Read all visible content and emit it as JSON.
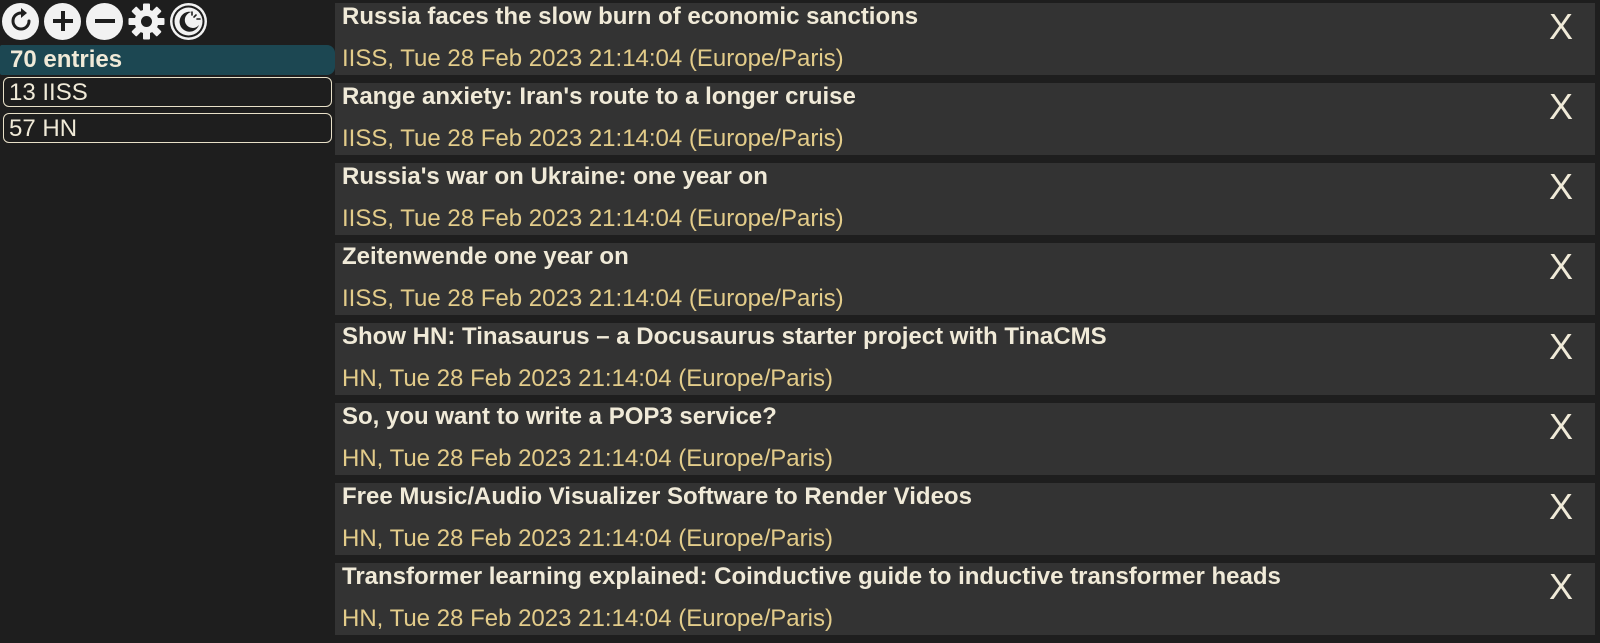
{
  "toolbar": {
    "icons": [
      "refresh-icon",
      "plus-icon",
      "minus-icon",
      "gear-icon",
      "theme-icon"
    ]
  },
  "sidebar": {
    "all_label": "70 entries",
    "feeds": [
      {
        "label": "13 IISS"
      },
      {
        "label": "57 HN"
      }
    ]
  },
  "entries": [
    {
      "title": "Russia faces the slow burn of economic sanctions",
      "meta": "IISS, Tue 28 Feb 2023 21:14:04 (Europe/Paris)",
      "close": "X"
    },
    {
      "title": "Range anxiety: Iran's route to a longer cruise",
      "meta": "IISS, Tue 28 Feb 2023 21:14:04 (Europe/Paris)",
      "close": "X"
    },
    {
      "title": "Russia's war on Ukraine: one year on",
      "meta": "IISS, Tue 28 Feb 2023 21:14:04 (Europe/Paris)",
      "close": "X"
    },
    {
      "title": "Zeitenwende one year on",
      "meta": "IISS, Tue 28 Feb 2023 21:14:04 (Europe/Paris)",
      "close": "X"
    },
    {
      "title": "Show HN: Tinasaurus – a Docusaurus starter project with TinaCMS",
      "meta": "HN, Tue 28 Feb 2023 21:14:04 (Europe/Paris)",
      "close": "X"
    },
    {
      "title": "So, you want to write a POP3 service?",
      "meta": "HN, Tue 28 Feb 2023 21:14:04 (Europe/Paris)",
      "close": "X"
    },
    {
      "title": "Free Music/Audio Visualizer Software to Render Videos",
      "meta": "HN, Tue 28 Feb 2023 21:14:04 (Europe/Paris)",
      "close": "X"
    },
    {
      "title": "Transformer learning explained: Coinductive guide to inductive transformer heads",
      "meta": "HN, Tue 28 Feb 2023 21:14:04 (Europe/Paris)",
      "close": "X"
    }
  ],
  "colors": {
    "background": "#1e1e1e",
    "entry_background": "#333333",
    "title_text": "#f0ead8",
    "meta_text": "#e3cc8a",
    "selected_feed": "#1c4752"
  }
}
